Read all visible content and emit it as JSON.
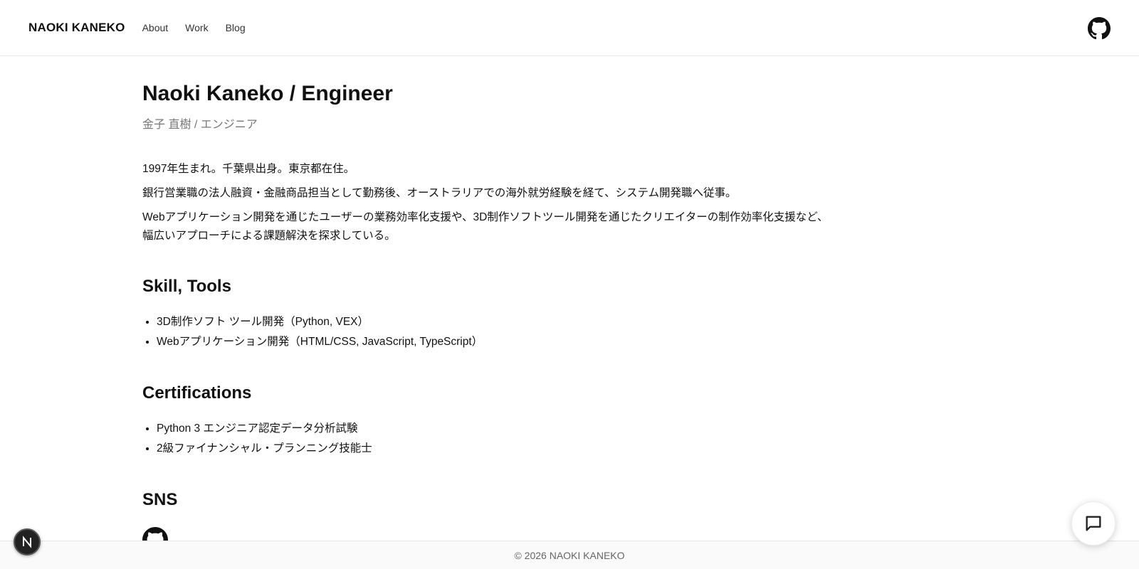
{
  "header": {
    "brand": "NAOKI KANEKO",
    "nav": [
      {
        "label": "About"
      },
      {
        "label": "Work"
      },
      {
        "label": "Blog"
      }
    ],
    "github_icon": "github-icon"
  },
  "main": {
    "title": "Naoki Kaneko / Engineer",
    "subtitle": "金子 直樹 / エンジニア",
    "bio": [
      "1997年生まれ。千葉県出身。東京都在住。",
      "銀行営業職の法人融資・金融商品担当として勤務後、オーストラリアでの海外就労経験を経て、システム開発職へ従事。",
      "Webアプリケーション開発を通じたユーザーの業務効率化支援や、3D制作ソフトツール開発を通じたクリエイターの制作効率化支援など、",
      "幅広いアプローチによる課題解決を探求している。"
    ],
    "skills": {
      "heading": "Skill, Tools",
      "items": [
        "3D制作ソフト ツール開発（Python, VEX）",
        "Webアプリケーション開発（HTML/CSS, JavaScript, TypeScript）"
      ]
    },
    "certifications": {
      "heading": "Certifications",
      "items": [
        "Python 3 エンジニア認定データ分析試験",
        "2級ファイナンシャル・プランニング技能士"
      ]
    },
    "sns": {
      "heading": "SNS",
      "icon": "github-icon"
    }
  },
  "footer": {
    "copyright": "© 2026 NAOKI KANEKO"
  },
  "overlays": {
    "badge_icon": "nextjs-n-icon",
    "chat_icon": "chat-bubble-icon"
  }
}
